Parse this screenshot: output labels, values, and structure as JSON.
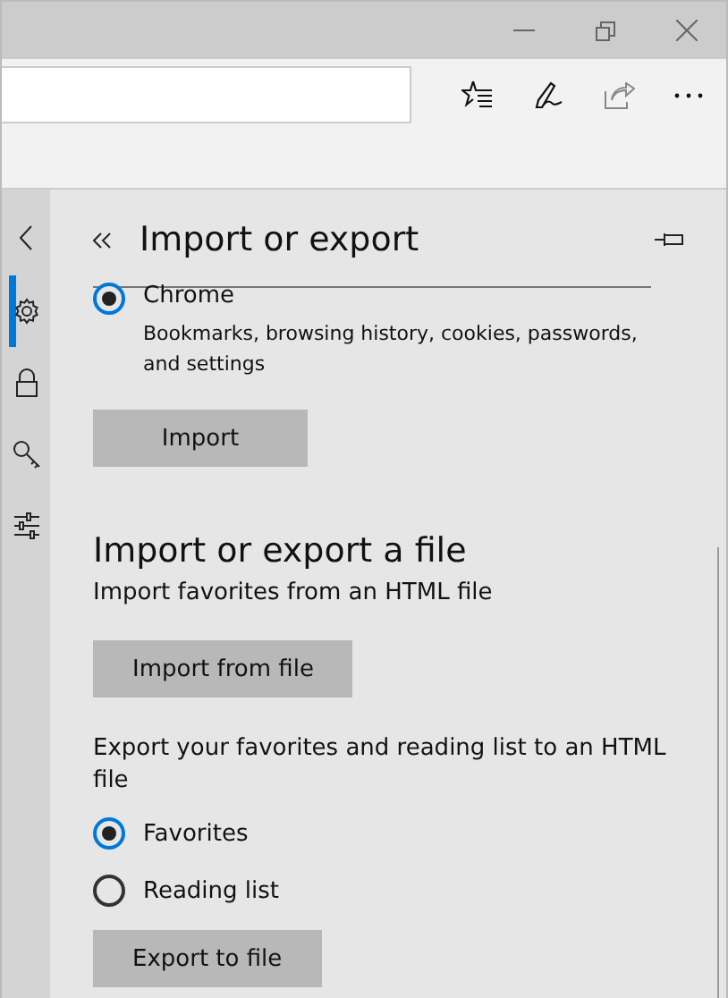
{
  "sidebar": {
    "items": [
      {
        "kind": "back",
        "selected": false
      },
      {
        "kind": "gear",
        "selected": true
      },
      {
        "kind": "lock",
        "selected": false
      },
      {
        "kind": "key",
        "selected": false
      },
      {
        "kind": "sliders",
        "selected": false
      }
    ]
  },
  "panel": {
    "title": "Import or export",
    "browser_option": {
      "label": "Chrome",
      "selected": true,
      "description": "Bookmarks, browsing history, cookies, passwords, and settings"
    },
    "import_button": "Import",
    "file_section": {
      "heading": "Import or export a file",
      "import_text": "Import favorites from an HTML file",
      "import_button": "Import from file",
      "export_text": "Export your favorites and reading list to an HTML file",
      "export_options": [
        {
          "label": "Favorites",
          "selected": true
        },
        {
          "label": "Reading list",
          "selected": false
        }
      ],
      "export_button": "Export to file"
    }
  }
}
